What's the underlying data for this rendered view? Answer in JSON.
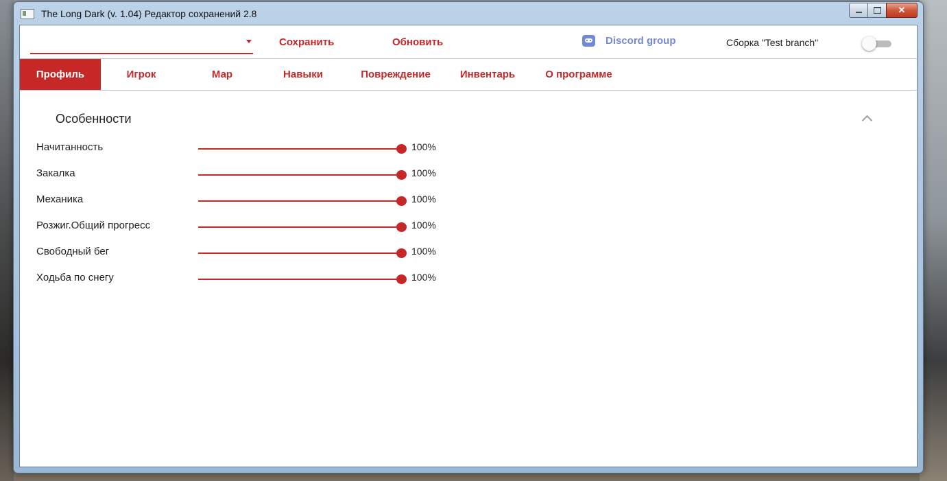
{
  "window": {
    "title": "The Long Dark (v. 1.04) Редактор сохранений 2.8",
    "min_label": "",
    "max_label": "",
    "close_label": "✕"
  },
  "toolbar": {
    "profile_value": "",
    "save_label": "Сохранить",
    "refresh_label": "Обновить",
    "discord_label": "Discord group",
    "test_branch_label": "Сборка \"Test branch\"",
    "test_branch_enabled": false
  },
  "tabs": [
    {
      "label": "Профиль",
      "active": true
    },
    {
      "label": "Игрок",
      "active": false
    },
    {
      "label": "Мар",
      "active": false
    },
    {
      "label": "Навыки",
      "active": false
    },
    {
      "label": "Повреждение",
      "active": false
    },
    {
      "label": "Инвентарь",
      "active": false
    },
    {
      "label": "О программе",
      "active": false
    }
  ],
  "section": {
    "title": "Особенности",
    "expanded": true
  },
  "features": [
    {
      "label": "Начитанность",
      "value": "100%",
      "level": 1.0
    },
    {
      "label": "Закалка",
      "value": "100%",
      "level": 1.0
    },
    {
      "label": "Механика",
      "value": "100%",
      "level": 1.0
    },
    {
      "label": "Розжиг.Общий прогресс",
      "value": "100%",
      "level": 1.0
    },
    {
      "label": "Свободный бег",
      "value": "100%",
      "level": 1.0
    },
    {
      "label": "Ходьба по снегу",
      "value": "100%",
      "level": 1.0
    }
  ],
  "colors": {
    "accent": "#c62828",
    "discord": "#7289da"
  }
}
